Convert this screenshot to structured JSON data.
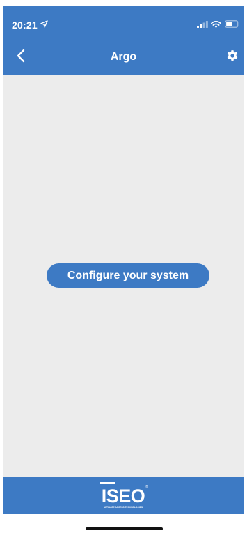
{
  "status_bar": {
    "time": "20:21",
    "location_icon": "location-arrow-icon",
    "signal_icon": "cellular-signal-icon",
    "wifi_icon": "wifi-icon",
    "battery_icon": "battery-icon"
  },
  "nav": {
    "back_icon": "chevron-left-icon",
    "title": "Argo",
    "settings_icon": "gear-icon"
  },
  "main": {
    "configure_button_label": "Configure your system"
  },
  "footer": {
    "logo_text": "ISEO",
    "logo_tagline": "ULTIMATE ACCESS TECHNOLOGIES"
  },
  "colors": {
    "primary": "#3d7ac4",
    "background": "#ececec",
    "text_on_primary": "#ffffff"
  }
}
